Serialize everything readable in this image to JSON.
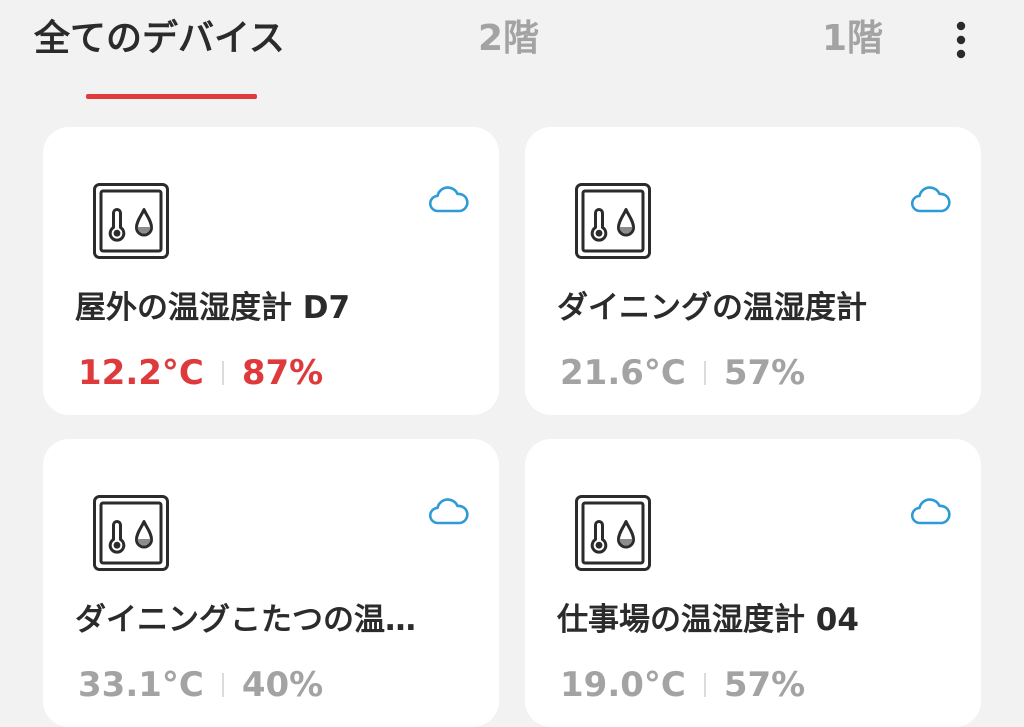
{
  "tabs": [
    {
      "label": "全てのデバイス",
      "active": true
    },
    {
      "label": "2階",
      "active": false
    },
    {
      "label": "1階",
      "active": false
    }
  ],
  "more_menu_icon": "vertical-ellipsis-icon",
  "colors": {
    "accent": "#e03a3c",
    "alert_text": "#de3a3c",
    "muted_text": "#a3a3a3",
    "primary_text": "#2b2b2b",
    "cloud": "#2f9bd6",
    "background": "#f2f2f2",
    "card": "#ffffff"
  },
  "devices": [
    {
      "name": "屋外の温湿度計 D7",
      "temperature": "12.2°C",
      "humidity": "87%",
      "state": "alert",
      "device_icon": "thermo-hygrometer-icon",
      "status_icon": "cloud-icon"
    },
    {
      "name": "ダイニングの温湿度計",
      "temperature": "21.6°C",
      "humidity": "57%",
      "state": "normal",
      "device_icon": "thermo-hygrometer-icon",
      "status_icon": "cloud-icon"
    },
    {
      "name": "ダイニングこたつの温…",
      "temperature": "33.1°C",
      "humidity": "40%",
      "state": "normal",
      "device_icon": "thermo-hygrometer-icon",
      "status_icon": "cloud-icon"
    },
    {
      "name": "仕事場の温湿度計 04",
      "temperature": "19.0°C",
      "humidity": "57%",
      "state": "normal",
      "device_icon": "thermo-hygrometer-icon",
      "status_icon": "cloud-icon"
    }
  ]
}
